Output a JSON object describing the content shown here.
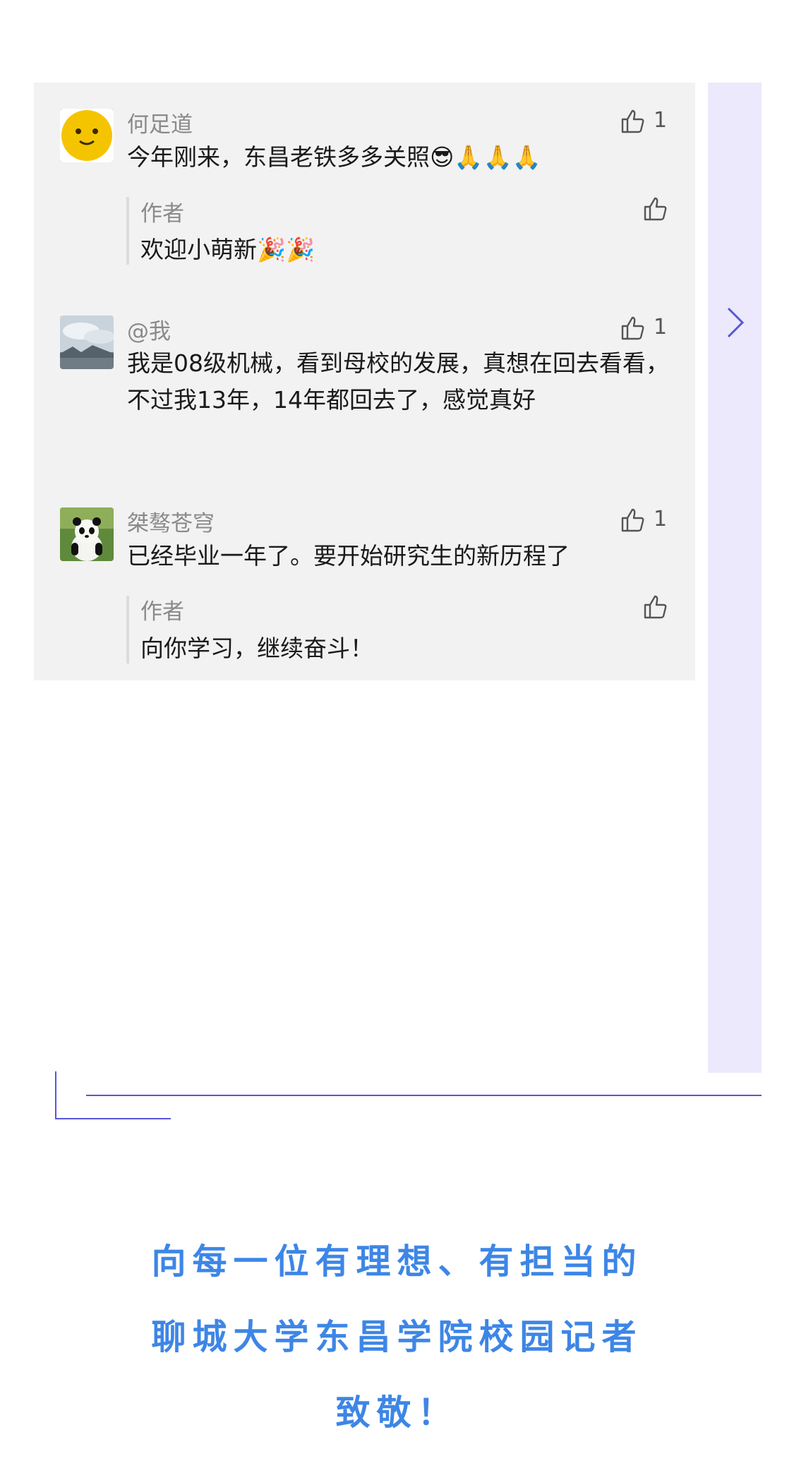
{
  "comments": [
    {
      "name": "何足道",
      "text": "今年刚来，东昌老铁多多关照😎🙏🙏🙏",
      "likes": "1",
      "avatar_icon": "yellow-emoji-face-avatar",
      "reply": {
        "label": "作者",
        "text": "欢迎小萌新🎉🎉"
      }
    },
    {
      "name": "@我",
      "text": "我是08级机械，看到母校的发展，真想在回去看看，不过我13年，14年都回去了，感觉真好",
      "likes": "1",
      "avatar_icon": "cloudy-landscape-avatar"
    },
    {
      "name": "桀骜苍穹",
      "text": "已经毕业一年了。要开始研究生的新历程了",
      "likes": "1",
      "avatar_icon": "panda-avatar",
      "reply": {
        "label": "作者",
        "text": "向你学习，继续奋斗！"
      }
    }
  ],
  "tribute": {
    "line1": "向每一位有理想、有担当的",
    "line2": "聊城大学东昌学院校园记者",
    "line3": "致敬！"
  },
  "colors": {
    "accent": "#5a55d8",
    "tribute_text": "#3d86e6",
    "panel_bg": "#f2f2f2",
    "side_strip_bg": "#ebe9fb"
  }
}
